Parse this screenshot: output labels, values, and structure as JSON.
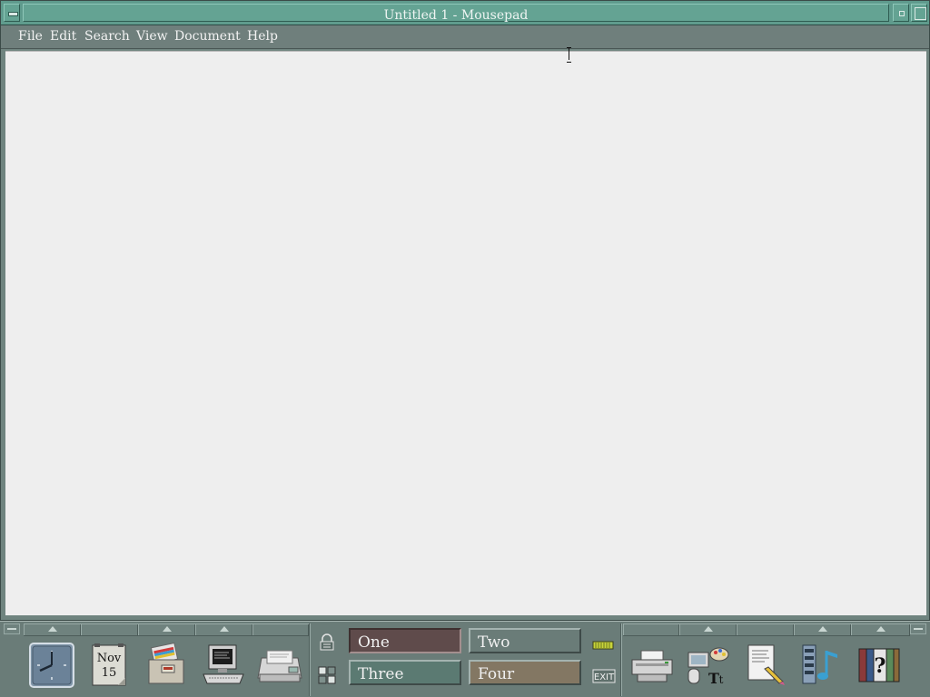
{
  "window": {
    "title": "Untitled 1 - Mousepad"
  },
  "menubar": {
    "items": [
      {
        "label": "File"
      },
      {
        "label": "Edit"
      },
      {
        "label": "Search"
      },
      {
        "label": "View"
      },
      {
        "label": "Document"
      },
      {
        "label": "Help"
      }
    ]
  },
  "editor": {
    "content": ""
  },
  "panel": {
    "calendar": {
      "month": "Nov",
      "day": "15"
    },
    "workspaces": [
      {
        "label": "One",
        "active": true
      },
      {
        "label": "Two",
        "active": false
      },
      {
        "label": "Three",
        "active": false
      },
      {
        "label": "Four",
        "active": false
      }
    ],
    "exit_label": "EXIT",
    "launchers_left": [
      "clock-icon",
      "calendar-icon",
      "file-manager-icon",
      "terminal-icon",
      "mail-icon"
    ],
    "launchers_right": [
      "printer-icon",
      "style-manager-icon",
      "text-editor-icon",
      "media-player-icon",
      "help-icon"
    ]
  },
  "colors": {
    "titlebar": "#5f9b8d",
    "menubar": "#6f7f7c",
    "editor_bg": "#eeeeee",
    "panel": "#6a7c78",
    "ws_one": "#5f4b4b",
    "ws_two": "#6a7c78",
    "ws_three": "#5b7a72",
    "ws_four": "#837763"
  }
}
